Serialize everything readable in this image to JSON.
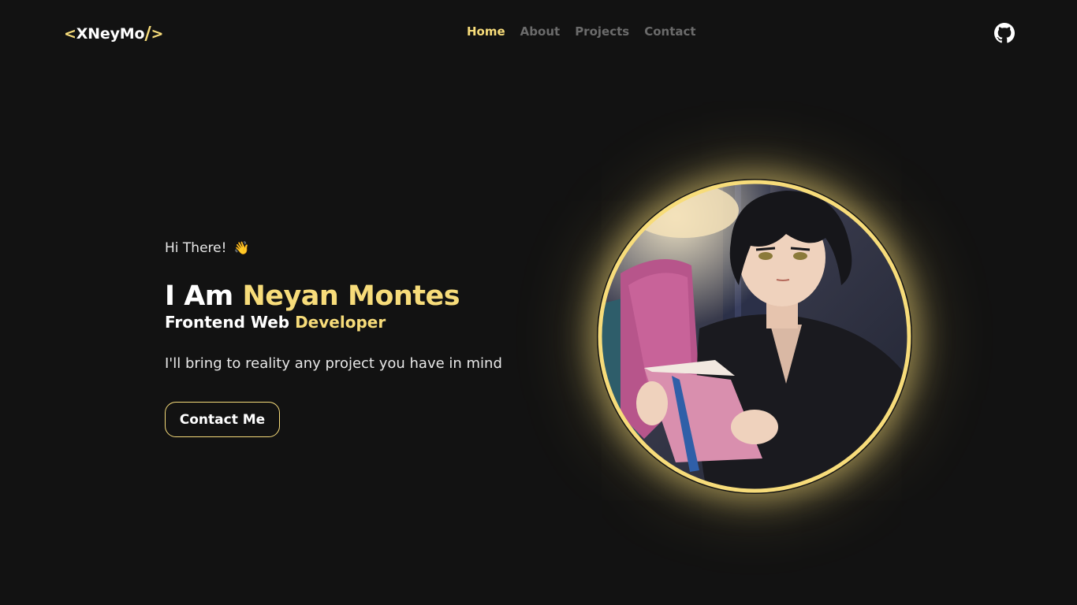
{
  "header": {
    "logo": {
      "open": "<",
      "name": "XNeyMo",
      "slash": "/",
      "close": ">"
    },
    "nav": [
      {
        "label": "Home",
        "active": true
      },
      {
        "label": "About",
        "active": false
      },
      {
        "label": "Projects",
        "active": false
      },
      {
        "label": "Contact",
        "active": false
      }
    ],
    "github_icon": "github-icon"
  },
  "hero": {
    "greeting": "Hi There!",
    "greeting_emoji": "👋",
    "headline_prefix": "I Am",
    "headline_name": "Neyan Montes",
    "role_main": "Frontend Web",
    "role_accent": "Developer",
    "tagline": "I'll bring to reality any project you have in mind",
    "cta_label": "Contact Me"
  },
  "colors": {
    "background": "#121212",
    "accent": "#f7dc7a",
    "nav_inactive": "#6b6b6b",
    "text": "#ffffff"
  }
}
